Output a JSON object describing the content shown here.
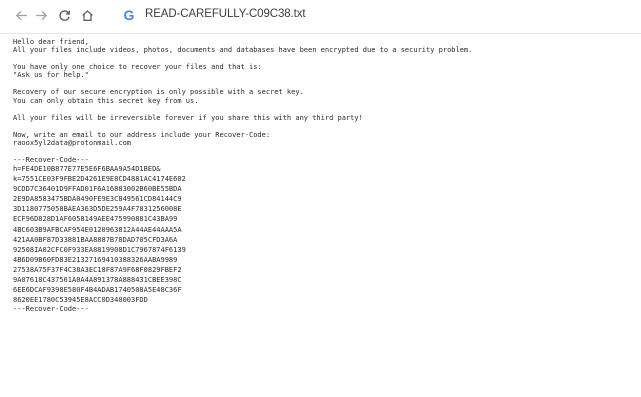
{
  "toolbar": {
    "back_icon": "back-arrow-icon",
    "forward_icon": "forward-arrow-icon",
    "reload_icon": "reload-icon",
    "home_icon": "home-icon",
    "site_icon": "google-search-icon",
    "site_icon_glyph": "G",
    "url": "READ-CAREFULLY-C09C38.txt"
  },
  "document": {
    "lines": {
      "greeting": "Hello dear friend,",
      "encrypted": "All your files include videos, photos, documents and databases have been encrypted due to a security problem.",
      "choice": "You have only one choice to recover your files and that is:",
      "ask": "\"Ask us for help.\"",
      "recovery": "Recovery of our secure encryption is only possible with a secret key.",
      "obtain": "You can only obtain this secret key from us.",
      "warning": "All your files will be irreversible forever if you share this with any third party!",
      "write": "Now, write an email to our address include your Recover-Code:",
      "email": "raoox5yl2data@protonmail.com",
      "code_start": "---Recover-Code---",
      "code_end": "---Recover-Code---"
    },
    "recover_code": [
      "h=FE4DE10B877E77E5E6F6BAA9A54D1BED&",
      "k=7551CE03F9FBE2D4261E9E8CD4881AC4174E602",
      "9CDD7C36401D9FFAD01F6A16883002B60BE55BDA",
      "2E9DA8583475BDA0490FE9E3C849561CD84144C9",
      "3D1180775058BAEA363D5DE259A4F7831256008E",
      "ECF96D828D1AF6058149AEE475990881C43BA99",
      "4BC603B9AFBCAF954E0120963812A44AE44AAA5A",
      "421AA0BF87D33881BAA8887B78DAD705CFD3A6A",
      "92508IA02CFC0F933EA8819908D1C7967874F6139",
      "4B6D09B60FD83E21327169410388326AABA9989",
      "27538A75F37F4C38A3EC18F87A9F68F0829FBEF2",
      "9A07618C437561A0A4A891378A888431CBEE398C",
      "6EE6DCAF9398E580F4B4ADAB1740508A5E48C36F",
      "8620EE1780C53945E8ACC0D340003FDD"
    ]
  }
}
